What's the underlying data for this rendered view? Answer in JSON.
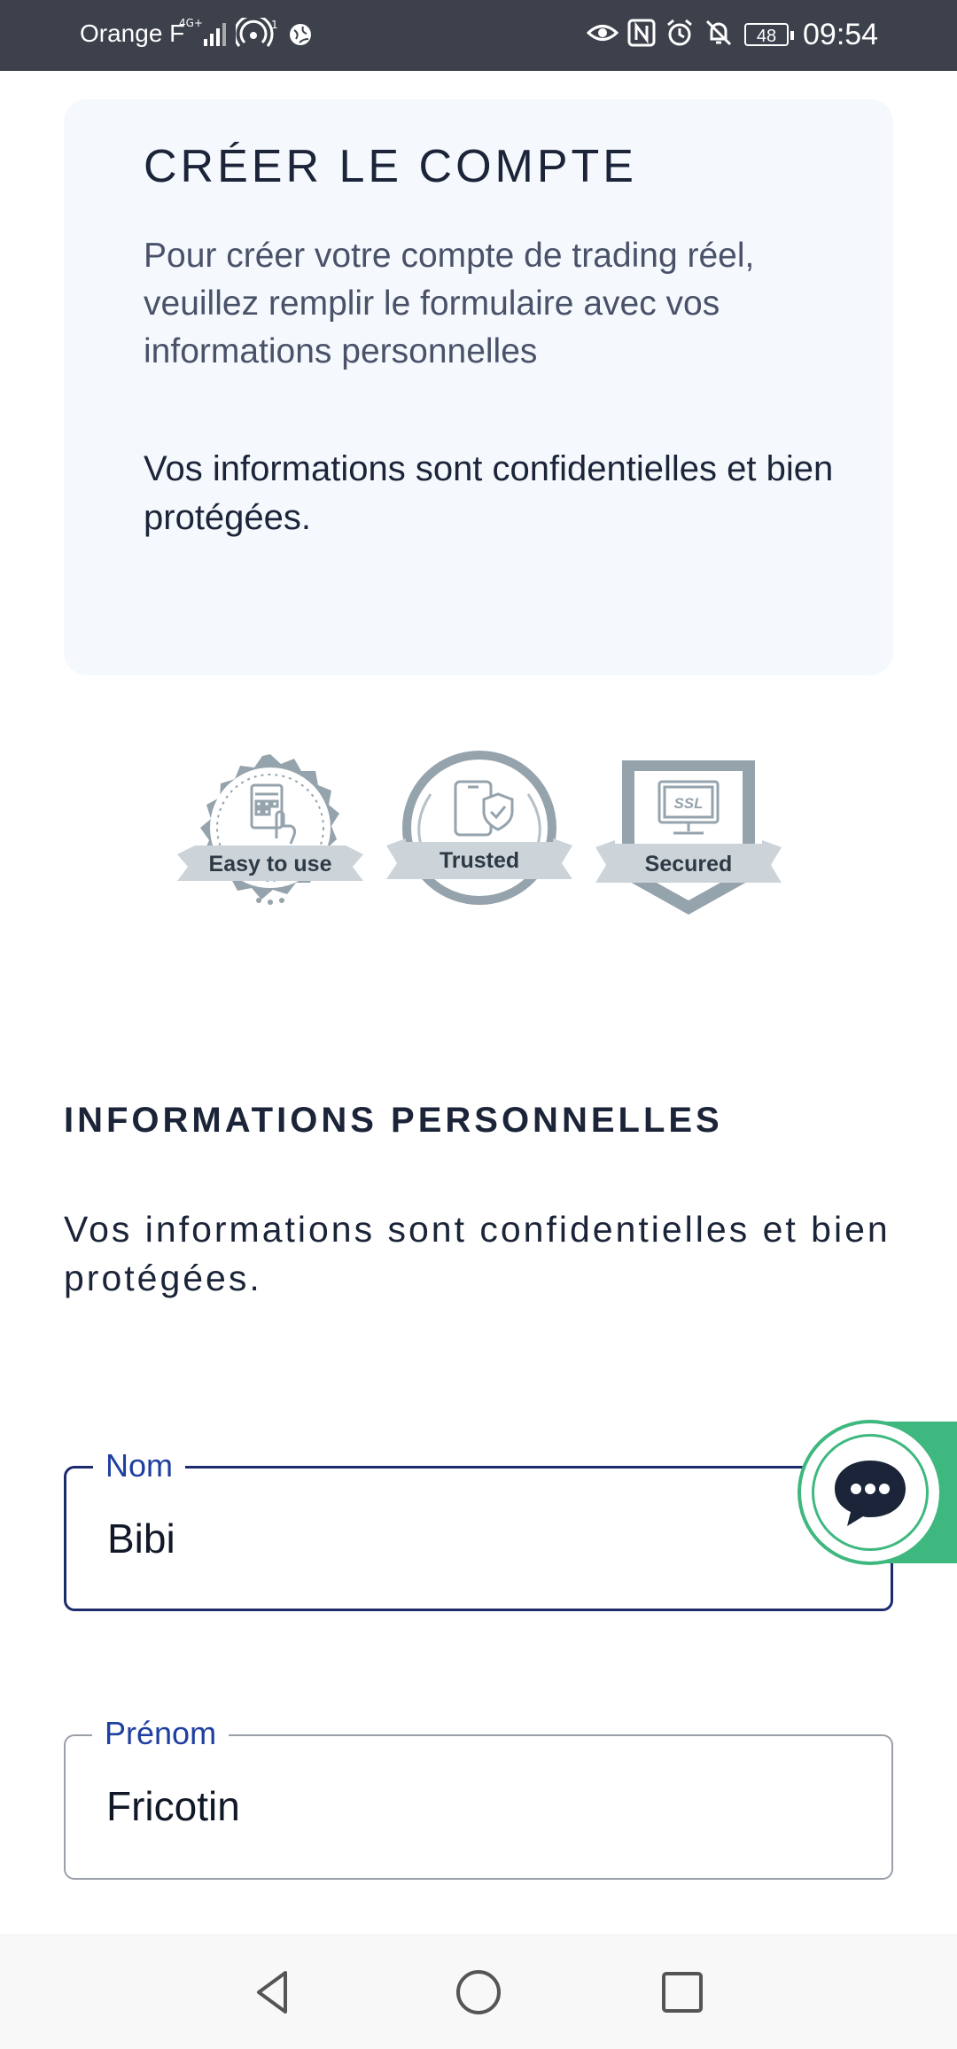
{
  "status_bar": {
    "carrier": "Orange F",
    "battery": "48",
    "time": "09:54"
  },
  "intro": {
    "title": "CRÉER LE COMPTE",
    "description": "Pour créer votre compte de trading réel, veuillez remplir le formulaire avec vos informations personnelles",
    "note": "Vos informations sont confidentielles et bien protégées."
  },
  "badges": [
    {
      "label": "Easy to use",
      "icon": "touch-calculator-icon"
    },
    {
      "label": "Trusted",
      "icon": "phone-shield-icon"
    },
    {
      "label": "Secured",
      "icon": "ssl-monitor-icon",
      "screen_text": "SSL"
    }
  ],
  "personal_info": {
    "heading": "INFORMATIONS PERSONNELLES",
    "subtitle": "Vos informations sont confidentielles et bien protégées."
  },
  "form": {
    "nom": {
      "label": "Nom",
      "value": "Bibi"
    },
    "prenom": {
      "label": "Prénom",
      "value": "Fricotin"
    }
  },
  "colors": {
    "accent_navy": "#1c2b6e",
    "label_blue": "#1f3fa0",
    "chat_green": "#3fb87f",
    "card_bg": "#f5f9fd",
    "status_bar_bg": "#3c414c",
    "badge_gray": "#95a3ad"
  },
  "icons": {
    "chat": "chat-bubble-icon",
    "nav_back": "back-triangle-icon",
    "nav_home": "home-circle-icon",
    "nav_recents": "recents-square-icon"
  }
}
